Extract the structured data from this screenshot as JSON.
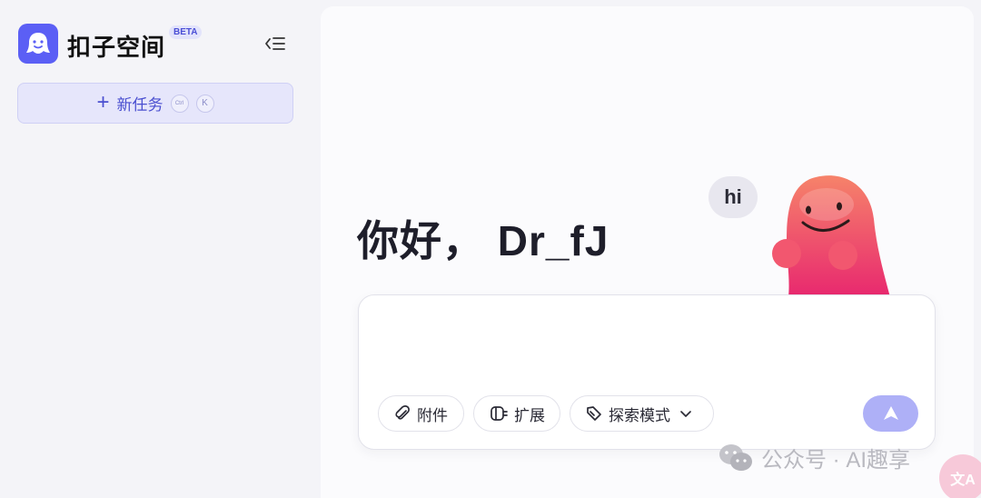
{
  "sidebar": {
    "brand": "扣子空间",
    "beta_badge": "BETA",
    "new_task": {
      "label": "新任务",
      "shortcut_modifier": "Ctrl",
      "shortcut_key": "K"
    }
  },
  "main": {
    "greeting": "你好， Dr_fJ",
    "bubble_text": "hi",
    "input": {
      "placeholder": "",
      "value": ""
    },
    "toolbar": {
      "attach_label": "附件",
      "expand_label": "扩展",
      "mode_label": "探索模式"
    }
  },
  "watermark": {
    "text": "公众号 · AI趣享"
  },
  "colors": {
    "brand": "#5b5ff5",
    "accent_text": "#4a4fd0",
    "send_button": "#aeb0f7",
    "mascot_top": "#f6836a",
    "mascot_bottom": "#e8286f"
  }
}
